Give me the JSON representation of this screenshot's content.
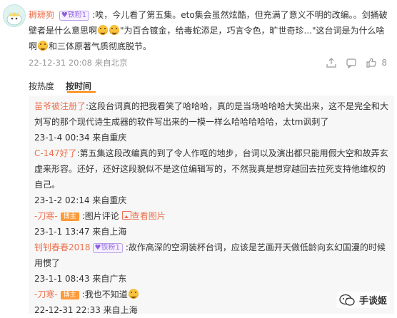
{
  "comment": {
    "username": "耨耨狗",
    "fan_badge": "铁粉1",
    "text_parts": [
      ":唉，今儿看了第五集。eto集会虽然炫酷，但充满了意义不明的改编。。剑捅破壁者是什么意思啊",
      "\"为百合镀金，给毒蛇添足，巧言令色，旷世奇珍...\"这台词是为什么啥啊",
      "和三体原著气质彻底脱节。"
    ],
    "timestamp": "22-12-31 20:08 来自北京",
    "like_count": "8"
  },
  "sort": {
    "hot_label": "按热度",
    "time_label": "按时间"
  },
  "replies": [
    {
      "username": "苗爷被注册了",
      "text": ":这段台词真的把我看笑了哈哈哈，真的是当场哈哈哈大笑出来，这不是完全和大刘写的那个现代诗生成器的软件写出来的一模一样么哈哈哈哈哈，太tm讽刺了",
      "meta": "23-1-4 00:34 来自重庆"
    },
    {
      "username": "C-147好了",
      "text": ":第五集这段改编真的到了令人作呕的地步，台词以及演出都只能用假大空和故弄玄虚来形容。还好，还好这段貌似不是这位编辑写的，不然我真是想穿越回去拉死支持他维权的自己。",
      "meta": "23-1-2 02:14 来自重庆"
    },
    {
      "username": "-刀寒-",
      "badge": "博主",
      "text": ":图片评论",
      "link": "查看图片",
      "meta": "23-1-1 13:47 来自上海"
    },
    {
      "username": "钊钊春春2018",
      "fan_badge": "铁粉1",
      "text": ":故作高深的空洞装杯台词，应该是艺画开天做低龄向玄幻国漫的时候用惯了",
      "meta": "23-1-1 08:43 来自广东"
    },
    {
      "username": "-刀寒-",
      "badge": "博主",
      "text": ":我也不知道",
      "meta": "22-12-31 22:33 来自上海"
    }
  ],
  "watermark": "手谈姬",
  "colors": {
    "username": "#eb7350",
    "accent": "#ff8200",
    "meta": "#999999",
    "reply_bg": "#f7f7f7"
  }
}
